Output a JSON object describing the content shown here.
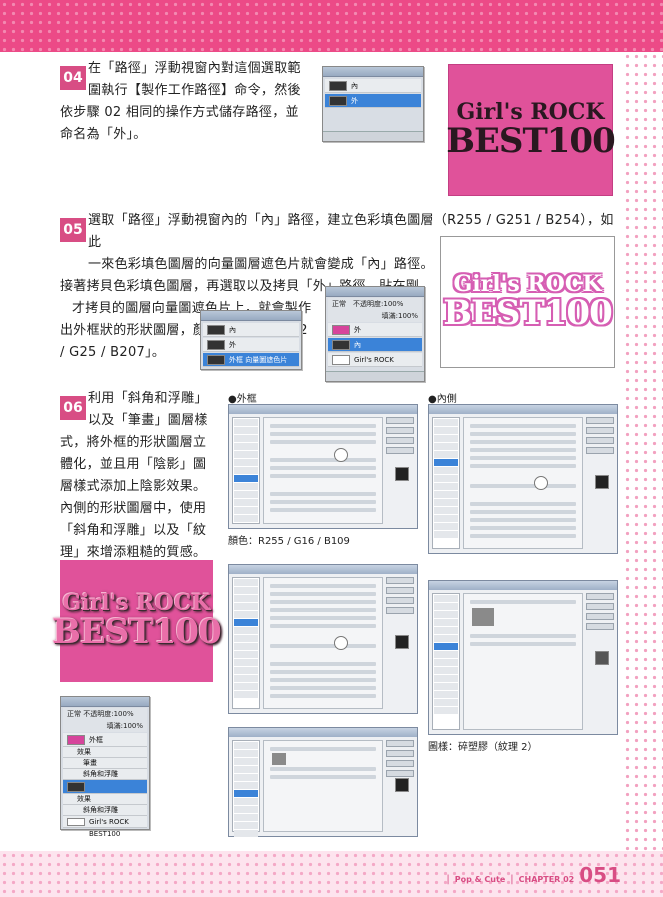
{
  "steps": [
    {
      "num": "04",
      "lines": [
        "在「路徑」浮動視窗內對這個選取範",
        "圍執行【製作工作路徑】命令，然後",
        "依步驟 02 相同的操作方式儲存路徑，並",
        "命名為「外」。"
      ]
    },
    {
      "num": "05",
      "lines": [
        "選取「路徑」浮動視窗內的「內」路徑，建立色彩填色圖層（R255 / G251 / B254），如此",
        "一來色彩填色圖層的向量圖層遮色片就會變成「內」路徑。",
        "接著拷貝色彩填色圖層，再選取以及拷貝「外」路徑，貼在剛",
        "才拷貝的圖層向量圖遮色片上，就會製作",
        "出外框狀的形狀圖層，顏色設定為「R252",
        "/ G25 / B207」。"
      ]
    },
    {
      "num": "06",
      "lines": [
        "利用「斜角和浮雕」",
        "以及「筆畫」圖層樣",
        "式，將外框的形狀圖層立",
        "體化，並且用「陰影」圖",
        "層樣式添加上陰影效果。",
        "內側的形狀圖層中，使用",
        "「斜角和浮雕」以及「紋",
        "理」來增添粗糙的質感。"
      ]
    }
  ],
  "panel_paths_1": {
    "rows": [
      "內",
      "外"
    ]
  },
  "panel_paths_2": {
    "rows": [
      "內",
      "外",
      "外框 向量圖遮色片"
    ]
  },
  "panel_layers_1": {
    "blend": "正常",
    "opacity_label": "不透明度:",
    "opacity": "100%",
    "fill_label": "填滿:",
    "fill": "100%",
    "rows": [
      "外",
      "內",
      "Girl's ROCK BEST100"
    ]
  },
  "panel_layers_2": {
    "blend": "正常",
    "opacity_label": "不透明度:",
    "opacity": "100%",
    "fill_label": "填滿:",
    "fill": "100%",
    "rows": [
      "外框",
      "效果",
      "筆畫",
      "斜角和浮雕",
      "效果",
      "斜角和浮雕",
      "Girl's ROCK BEST100"
    ]
  },
  "art": {
    "line1": "Girl's ROCK",
    "line2": "BEST100"
  },
  "labels": {
    "outer": "●外框",
    "inner": "●內側",
    "color_note": "顏色：R255 / G16 / B109",
    "pattern_note": "圖樣：碎塑膠（紋理 2）"
  },
  "folio": {
    "section": "Pop & Cute",
    "chapter": "CHAPTER 02",
    "page": "051"
  },
  "colors": {
    "accent": "#d84d84",
    "art_pink": "#e0529a",
    "outline_pink": "#d65eb3"
  }
}
